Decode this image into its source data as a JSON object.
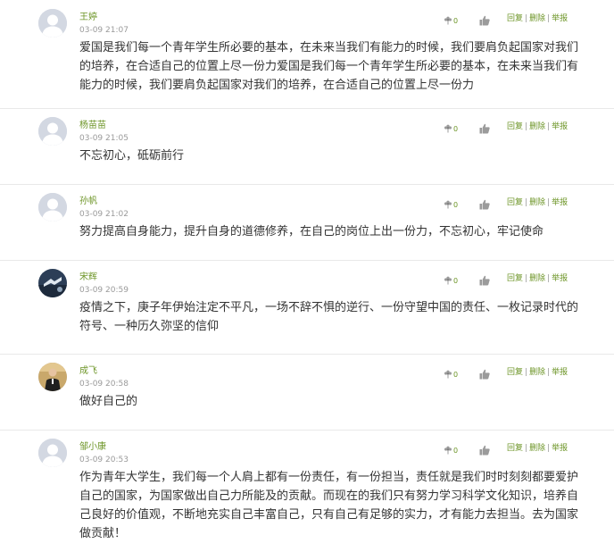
{
  "ui": {
    "reply_label": "回复",
    "delete_label": "删除",
    "report_label": "举报",
    "separator": "|",
    "colors": {
      "accent": "#6d9527",
      "icon": "#9b9b9b",
      "avatar_placeholder": "#d3d8e2",
      "divider": "#e9e9e9"
    }
  },
  "comments": [
    {
      "author": "王婷",
      "time": "03-09 21:07",
      "flower_count": "0",
      "avatar": "default-avatar",
      "text": "爱国是我们每一个青年学生所必要的基本，在未来当我们有能力的时候，我们要肩负起国家对我们的培养，在合适自己的位置上尽一份力爱国是我们每一个青年学生所必要的基本，在未来当我们有能力的时候，我们要肩负起国家对我们的培养，在合适自己的位置上尽一份力"
    },
    {
      "author": "杨苗苗",
      "time": "03-09 21:05",
      "flower_count": "0",
      "avatar": "default-avatar",
      "text": "不忘初心，砥砺前行"
    },
    {
      "author": "孙帆",
      "time": "03-09 21:02",
      "flower_count": "0",
      "avatar": "default-avatar",
      "text": "努力提高自身能力，提升自身的道德修养，在自己的岗位上出一份力，不忘初心，牢记使命"
    },
    {
      "author": "宋辉",
      "time": "03-09 20:59",
      "flower_count": "0",
      "avatar": "photo-avatar-dark",
      "text": "疫情之下，庚子年伊始注定不平凡，一场不辞不惧的逆行、一份守望中国的责任、一枚记录时代的符号、一种历久弥坚的信仰"
    },
    {
      "author": "成飞",
      "time": "03-09 20:58",
      "flower_count": "0",
      "avatar": "photo-avatar-person",
      "text": "做好自己的"
    },
    {
      "author": "邹小康",
      "time": "03-09 20:53",
      "flower_count": "0",
      "avatar": "default-avatar",
      "text": "作为青年大学生，我们每一个人肩上都有一份责任，有一份担当，责任就是我们时时刻刻都要爱护自己的国家，为国家做出自己力所能及的贡献。而现在的我们只有努力学习科学文化知识，培养自己良好的价值观，不断地充实自己丰富自己，只有自己有足够的实力，才有能力去担当。去为国家做贡献！"
    }
  ]
}
